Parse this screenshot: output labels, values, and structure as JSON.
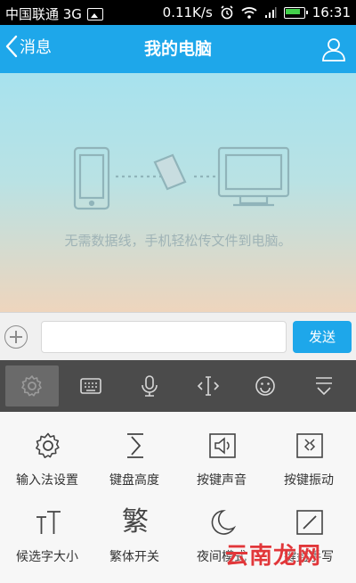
{
  "status_bar": {
    "carrier": "中国联通 3G",
    "speed": "0.11K/s",
    "time": "16:31"
  },
  "header": {
    "back_label": "消息",
    "title": "我的电脑"
  },
  "content": {
    "hint": "无需数据线，手机轻松传文件到电脑。"
  },
  "input_bar": {
    "placeholder": "",
    "send_label": "发送"
  },
  "toolbar": {
    "items": [
      {
        "icon": "gear-icon",
        "active": true
      },
      {
        "icon": "keyboard-icon"
      },
      {
        "icon": "microphone-icon"
      },
      {
        "icon": "text-cursor-icon"
      },
      {
        "icon": "emoji-icon"
      },
      {
        "icon": "collapse-keyboard-icon"
      }
    ]
  },
  "settings": {
    "items": [
      {
        "label": "输入法设置",
        "icon": "gear-icon"
      },
      {
        "label": "键盘高度",
        "icon": "keyboard-height-icon"
      },
      {
        "label": "按键声音",
        "icon": "key-sound-icon"
      },
      {
        "label": "按键振动",
        "icon": "key-vibration-icon"
      },
      {
        "label": "候选字大小",
        "icon": "candidate-size-icon"
      },
      {
        "label": "繁体开关",
        "icon": "traditional-toggle-icon",
        "glyph": "繁"
      },
      {
        "label": "夜间模式",
        "icon": "moon-icon"
      },
      {
        "label": "键盘手写",
        "icon": "handwriting-icon"
      }
    ]
  },
  "watermark": {
    "text": "云南龙网"
  }
}
